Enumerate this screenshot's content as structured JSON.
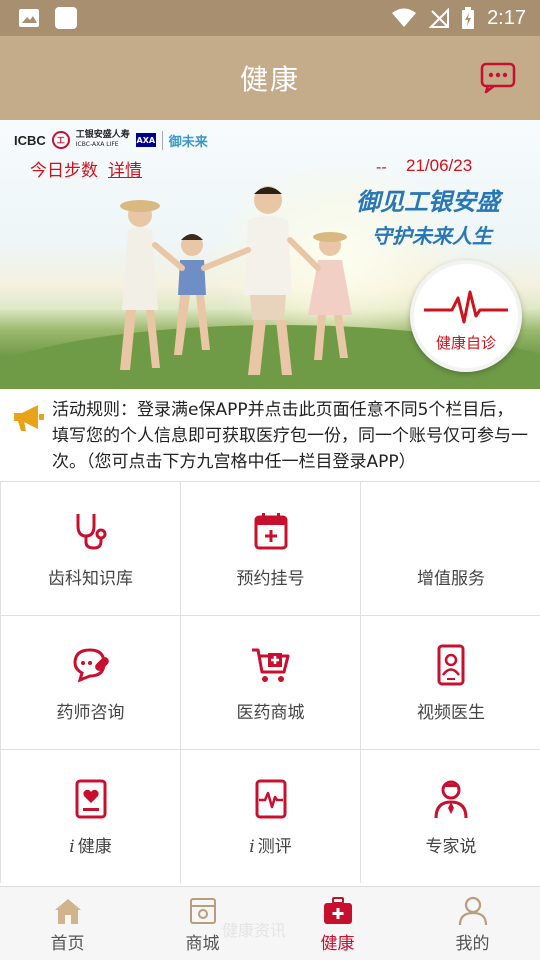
{
  "status_bar": {
    "time": "2:17",
    "icons": [
      "image-icon",
      "app-square-icon",
      "wifi-icon",
      "no-signal-icon",
      "battery-charging-icon"
    ]
  },
  "app_bar": {
    "title": "健康",
    "message_icon": "chat-bubble-icon"
  },
  "banner": {
    "logos": {
      "icbc": "ICBC",
      "icbc_mark": "工",
      "company_name": "工银安盛人寿",
      "company_name_en": "ICBC-AXA LIFE",
      "axa": "AXA",
      "brand": "御未来"
    },
    "steps_label": "今日步数",
    "steps_link": "详情",
    "step_count": "--",
    "date": "21/06/23",
    "slogan_line1": "御见工银安盛",
    "slogan_line2": "守护未来人生",
    "self_check_label": "健康自诊",
    "self_check_icon": "heartbeat-icon"
  },
  "notice": {
    "icon": "megaphone-icon",
    "text": "活动规则：登录满e保APP并点击此页面任意不同5个栏目后，填写您的个人信息即可获取医疗包一份，同一个账号仅可参与一次。（您可点击下方九宫格中任一栏目登录APP）"
  },
  "grid": [
    {
      "label": "齿科知识库",
      "icon": "stethoscope-icon"
    },
    {
      "label": "预约挂号",
      "icon": "calendar-plus-icon"
    },
    {
      "label": "增值服务",
      "icon": ""
    },
    {
      "label": "药师咨询",
      "icon": "pill-chat-icon"
    },
    {
      "label": "医药商城",
      "icon": "medical-cart-icon"
    },
    {
      "label": "视频医生",
      "icon": "video-doctor-icon"
    },
    {
      "prefix": "i",
      "label": "健康",
      "icon": "heart-document-icon"
    },
    {
      "prefix": "i",
      "label": "测评",
      "icon": "ecg-document-icon"
    },
    {
      "label": "专家说",
      "icon": "expert-doctor-icon"
    }
  ],
  "bottom_nav": {
    "items": [
      {
        "label": "首页",
        "icon": "home-icon",
        "active": false
      },
      {
        "label": "商城",
        "icon": "shop-icon",
        "active": false
      },
      {
        "label": "健康",
        "icon": "medical-kit-icon",
        "active": true
      },
      {
        "label": "我的",
        "icon": "person-icon",
        "active": false
      }
    ],
    "watermark": "健康资讯"
  },
  "colors": {
    "status_bar": "#a88f70",
    "app_bar": "#c4ab89",
    "accent_red": "#c8102e",
    "slogan_blue": "#2776b5",
    "grid_line": "#e0e0e0"
  }
}
